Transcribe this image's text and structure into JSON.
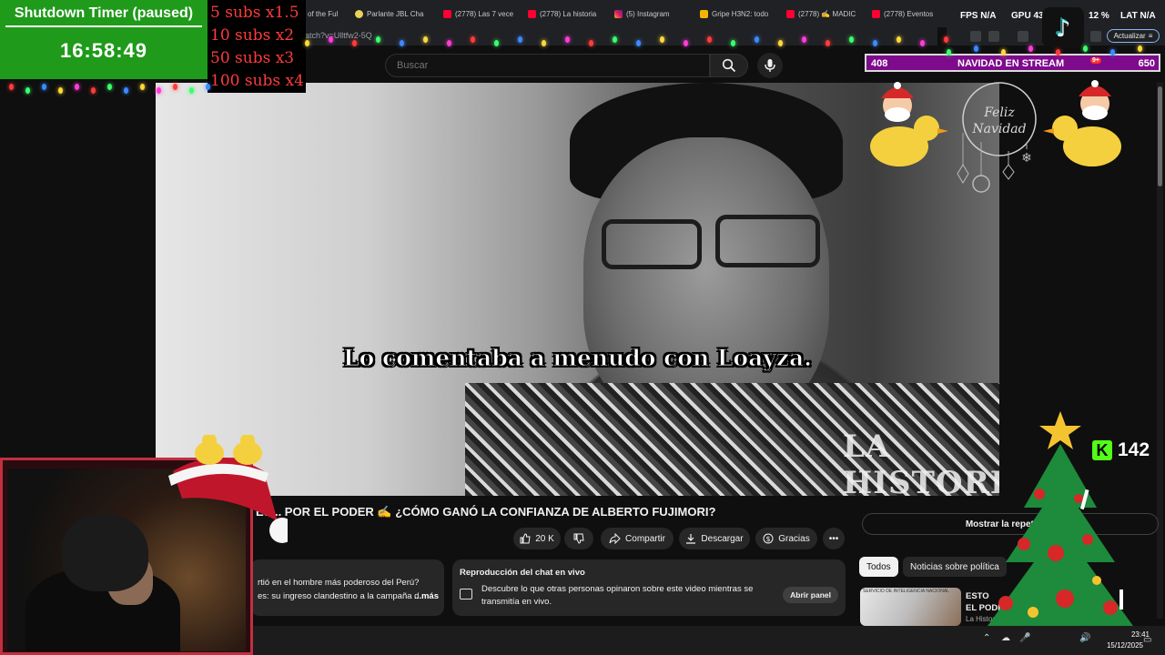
{
  "browser": {
    "tabs": [
      {
        "label": "of the Ful",
        "icon": "page-icon"
      },
      {
        "label": "Parlante JBL Cha",
        "icon": "store-icon"
      },
      {
        "label": "(2778) Las 7 vece",
        "icon": "youtube-icon"
      },
      {
        "label": "(2778) La historia",
        "icon": "youtube-icon"
      },
      {
        "label": "(5) Instagram",
        "icon": "instagram-icon"
      },
      {
        "label": "Gripe H3N2: todo",
        "icon": "news-icon"
      },
      {
        "label": "(2778) ✍️ MADIC",
        "icon": "youtube-icon"
      },
      {
        "label": "(2778) Eventos",
        "icon": "youtube-icon"
      }
    ],
    "url": "atch?v=Ulltfw2-5Q",
    "update_label": "Actualizar"
  },
  "stats": {
    "fps_label": "FPS",
    "fps_value": "N/A",
    "gpu_label": "GPU",
    "gpu_value": "43",
    "cpu_value": "12 %",
    "lat_label": "LAT",
    "lat_value": "N/A"
  },
  "timer": {
    "title": "Shutdown Timer (paused)",
    "time": "16:58:49"
  },
  "subs": [
    "5 subs x1.5",
    "10 subs x2",
    "50 subs x3",
    "100 subs x4"
  ],
  "youtube": {
    "search_placeholder": "Buscar",
    "video_subtitle": "Lo comentaba a menudo con Loayza.",
    "video_watermark": "LA HISTORIA",
    "title": "ES...  POR EL PODER ✍️ ¿CÓMO GANÓ LA CONFIANZA DE ALBERTO FUJIMORI?",
    "likes": "20 K",
    "share_label": "Compartir",
    "download_label": "Descargar",
    "thanks_label": "Gracias",
    "description_line1": "rtió en el hombre más poderoso del Perú?",
    "description_line2": "es: su ingreso clandestino a la campaña d",
    "description_more": "...más",
    "chat_title": "Reproducción del chat en vivo",
    "chat_text_line1": "Descubre lo que otras personas opinaron sobre este video mientras se",
    "chat_text_line2": "transmitía en vivo.",
    "chat_open": "Abrir panel",
    "replay_label": "Mostrar la repetición",
    "chips": [
      "Todos",
      "Noticias sobre política"
    ],
    "recommendation": {
      "title_line1": "ESTO",
      "title_line2": "EL PODER",
      "channel": "La Historia De...",
      "thumb_label": "SERVICIO DE INTELIGENCIA NACIONAL"
    }
  },
  "overlay": {
    "navidad_left": "408",
    "navidad_center": "NAVIDAD EN STREAM",
    "navidad_badge": "9+",
    "navidad_right": "650",
    "kick_count": "142",
    "feliz_navidad": "Feliz Navidad"
  },
  "taskbar": {
    "time": "23:41",
    "date": "15/12/2025"
  },
  "colors": {
    "timer_bg": "#1f9a1a",
    "subs_text": "#ff3b3b",
    "navidad_bg": "#7d0b8c",
    "kick_green": "#53fc18"
  }
}
